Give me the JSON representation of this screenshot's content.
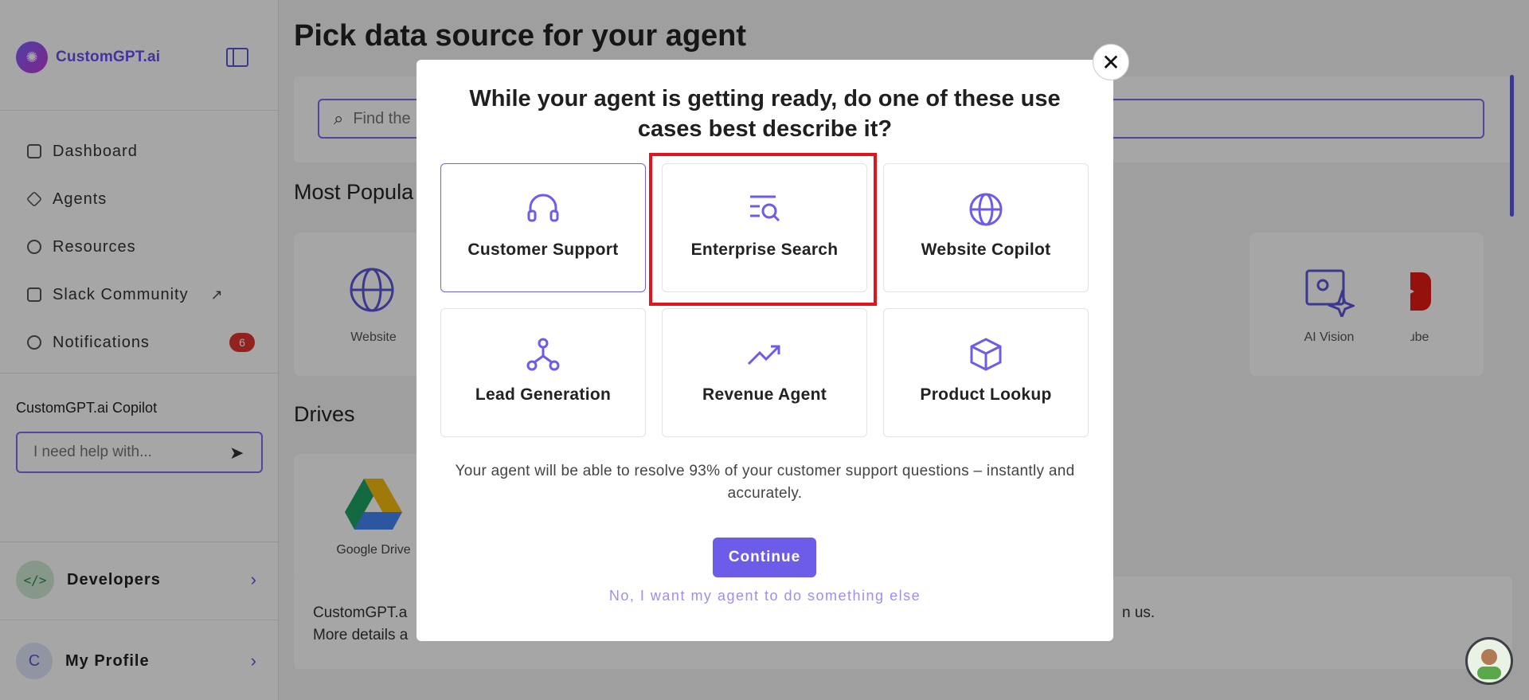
{
  "sidebar": {
    "brand": "CustomGPT.ai",
    "nav": [
      {
        "label": "Dashboard"
      },
      {
        "label": "Agents"
      },
      {
        "label": "Resources"
      },
      {
        "label": "Slack Community"
      },
      {
        "label": "Notifications",
        "badge": "6"
      }
    ],
    "copilot": {
      "title": "CustomGPT.ai Copilot",
      "placeholder": "I need help with..."
    },
    "developers": {
      "label": "Developers",
      "icon": "</>"
    },
    "profile": {
      "label": "My Profile",
      "initial": "C"
    }
  },
  "main": {
    "page_title": "Pick data source for your agent",
    "search_placeholder": "Find the",
    "most_popular_title": "Most Popula",
    "drives_title": "Drives",
    "tiles": [
      {
        "label": "Website"
      },
      {
        "label": "YouTube"
      },
      {
        "label": "AI Vision"
      }
    ],
    "drive_tile": {
      "label": "Google Drive"
    },
    "info": {
      "line1": "CustomGPT.a",
      "line2": "More details a",
      "right": "n us."
    }
  },
  "modal": {
    "title": "While your agent is getting ready, do one of these use cases best describe it?",
    "use_cases": [
      {
        "label": "Customer Support",
        "icon": "headset-icon"
      },
      {
        "label": "Enterprise Search",
        "icon": "search-list-icon"
      },
      {
        "label": "Website Copilot",
        "icon": "globe-icon"
      },
      {
        "label": "Lead Generation",
        "icon": "network-icon"
      },
      {
        "label": "Revenue Agent",
        "icon": "trending-up-icon"
      },
      {
        "label": "Product Lookup",
        "icon": "box-icon"
      }
    ],
    "selected": "Customer Support",
    "description": "Your agent will be able to resolve 93% of your customer support questions – instantly and accurately.",
    "continue_label": "Continue",
    "decline_label": "No, I want my agent to do something else"
  },
  "colors": {
    "accent": "#6c5ce7",
    "highlight": "#e3141b",
    "badge": "#e0352f"
  }
}
